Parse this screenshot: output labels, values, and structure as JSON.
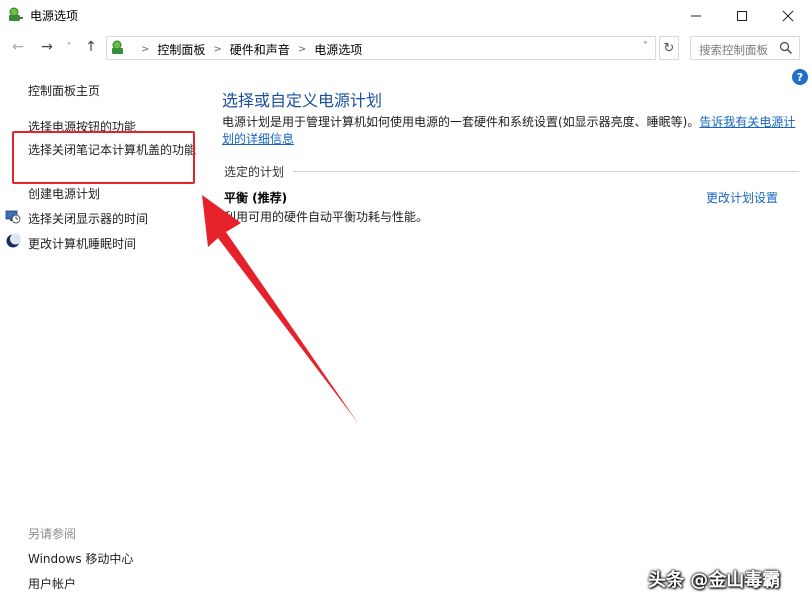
{
  "window": {
    "title": "电源选项",
    "minimize_glyph": "—",
    "maximize_glyph": "☐",
    "close_glyph": "✕"
  },
  "nav": {
    "back_glyph": "←",
    "forward_glyph": "→",
    "recent_glyph": "˅",
    "up_glyph": "↑",
    "breadcrumbs": [
      "控制面板",
      "硬件和声音",
      "电源选项"
    ],
    "separator": ">",
    "dropdown_glyph": "˅",
    "refresh_glyph": "↻",
    "search_placeholder": "搜索控制面板"
  },
  "help_glyph": "?",
  "left_pane": {
    "home": "控制面板主页",
    "items": {
      "power_buttons": "选择电源按钮的功能",
      "lid": "选择关闭笔记本计算机盖的功能",
      "create_plan": "创建电源计划",
      "display_off": "选择关闭显示器的时间",
      "sleep": "更改计算机睡眠时间"
    },
    "see_also": {
      "header": "另请参阅",
      "mobility": "Windows 移动中心",
      "accounts": "用户帐户"
    }
  },
  "main": {
    "title": "选择或自定义电源计划",
    "description": "电源计划是用于管理计算机如何使用电源的一套硬件和系统设置(如显示器亮度、睡眠等)。",
    "description_link": "告诉我有关电源计划的详细信息",
    "selected_header": "选定的计划",
    "plan": {
      "name": "平衡 (推荐)",
      "description": "利用可用的硬件自动平衡功耗与性能。",
      "change_link": "更改计划设置"
    }
  },
  "annotation": {
    "color": "#e5222a"
  },
  "watermark": "头条 @金山毒霸",
  "colors": {
    "title_blue": "#1a4fa0",
    "link_blue": "#1565c0",
    "help_blue": "#1e6fc9"
  }
}
